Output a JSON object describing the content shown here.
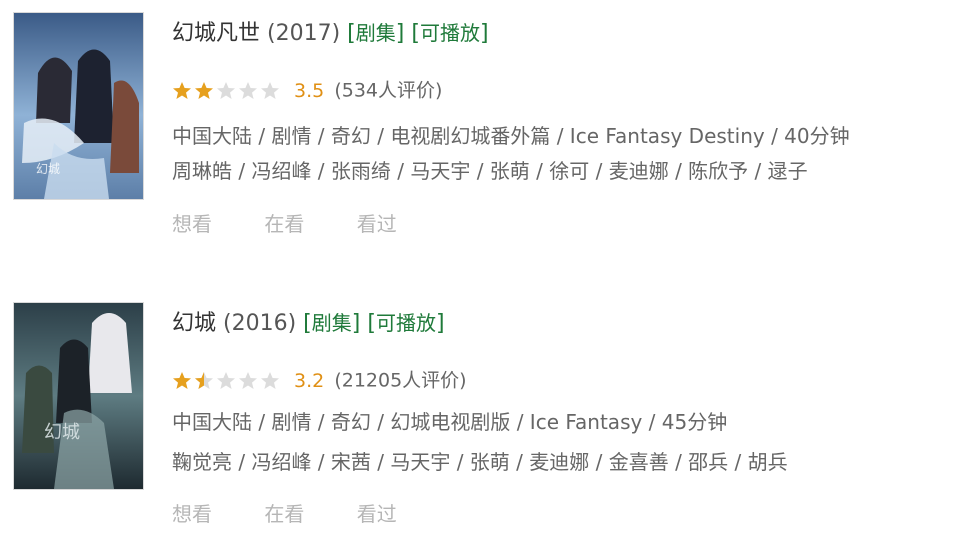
{
  "items": [
    {
      "title": "幻城凡世",
      "year": "(2017)",
      "tag_type": "剧集",
      "tag_play": "可播放",
      "score": "3.5",
      "votes": "(534人评价)",
      "stars_value": 1.75,
      "meta": "中国大陆 / 剧情 / 奇幻 / 电视剧幻城番外篇 / Ice Fantasy Destiny / 40分钟",
      "cast": "周琳皓 / 冯绍峰 / 张雨绮 / 马天宇 / 张萌 / 徐可 / 麦迪娜 / 陈欣予 / 逯子",
      "actions": [
        "想看",
        "在看",
        "看过"
      ]
    },
    {
      "title": "幻城",
      "year": "(2016)",
      "tag_type": "剧集",
      "tag_play": "可播放",
      "score": "3.2",
      "votes": "(21205人评价)",
      "stars_value": 1.5,
      "meta": "中国大陆 / 剧情 / 奇幻 / 幻城电视剧版 / Ice Fantasy / 45分钟",
      "cast": "鞠觉亮 / 冯绍峰 / 宋茜 / 马天宇 / 张萌 / 麦迪娜 / 金喜善 / 邵兵 / 胡兵",
      "actions": [
        "想看",
        "在看",
        "看过"
      ]
    }
  ]
}
